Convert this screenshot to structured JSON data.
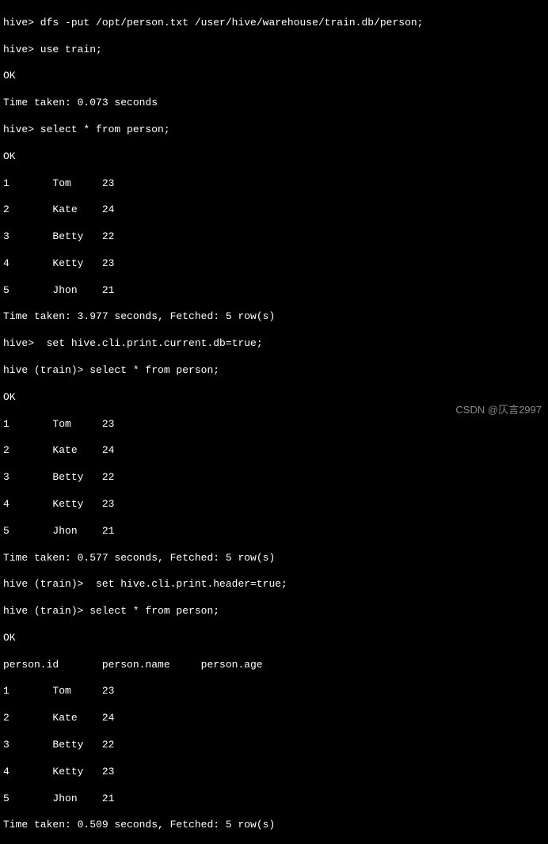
{
  "lines": {
    "l0": "hive> dfs -put /opt/person.txt /user/hive/warehouse/train.db/person;",
    "l1": "hive> use train;",
    "l2": "OK",
    "l3": "Time taken: 0.073 seconds",
    "l4": "hive> select * from person;",
    "l5": "OK",
    "l6": "1       Tom     23",
    "l7": "2       Kate    24",
    "l8": "3       Betty   22",
    "l9": "4       Ketty   23",
    "l10": "5       Jhon    21",
    "l11": "Time taken: 3.977 seconds, Fetched: 5 row(s)",
    "l12": "hive>  set hive.cli.print.current.db=true;",
    "l13": "hive (train)> select * from person;",
    "l14": "OK",
    "l15": "1       Tom     23",
    "l16": "2       Kate    24",
    "l17": "3       Betty   22",
    "l18": "4       Ketty   23",
    "l19": "5       Jhon    21",
    "l20": "Time taken: 0.577 seconds, Fetched: 5 row(s)",
    "l21": "hive (train)>  set hive.cli.print.header=true;",
    "l22": "hive (train)> select * from person;",
    "l23": "OK",
    "l24": "person.id       person.name     person.age",
    "l25": "1       Tom     23",
    "l26": "2       Kate    24",
    "l27": "3       Betty   22",
    "l28": "4       Ketty   23",
    "l29": "5       Jhon    21",
    "l30": "Time taken: 0.509 seconds, Fetched: 5 row(s)"
  },
  "watermark": "CSDN @仄言2997"
}
